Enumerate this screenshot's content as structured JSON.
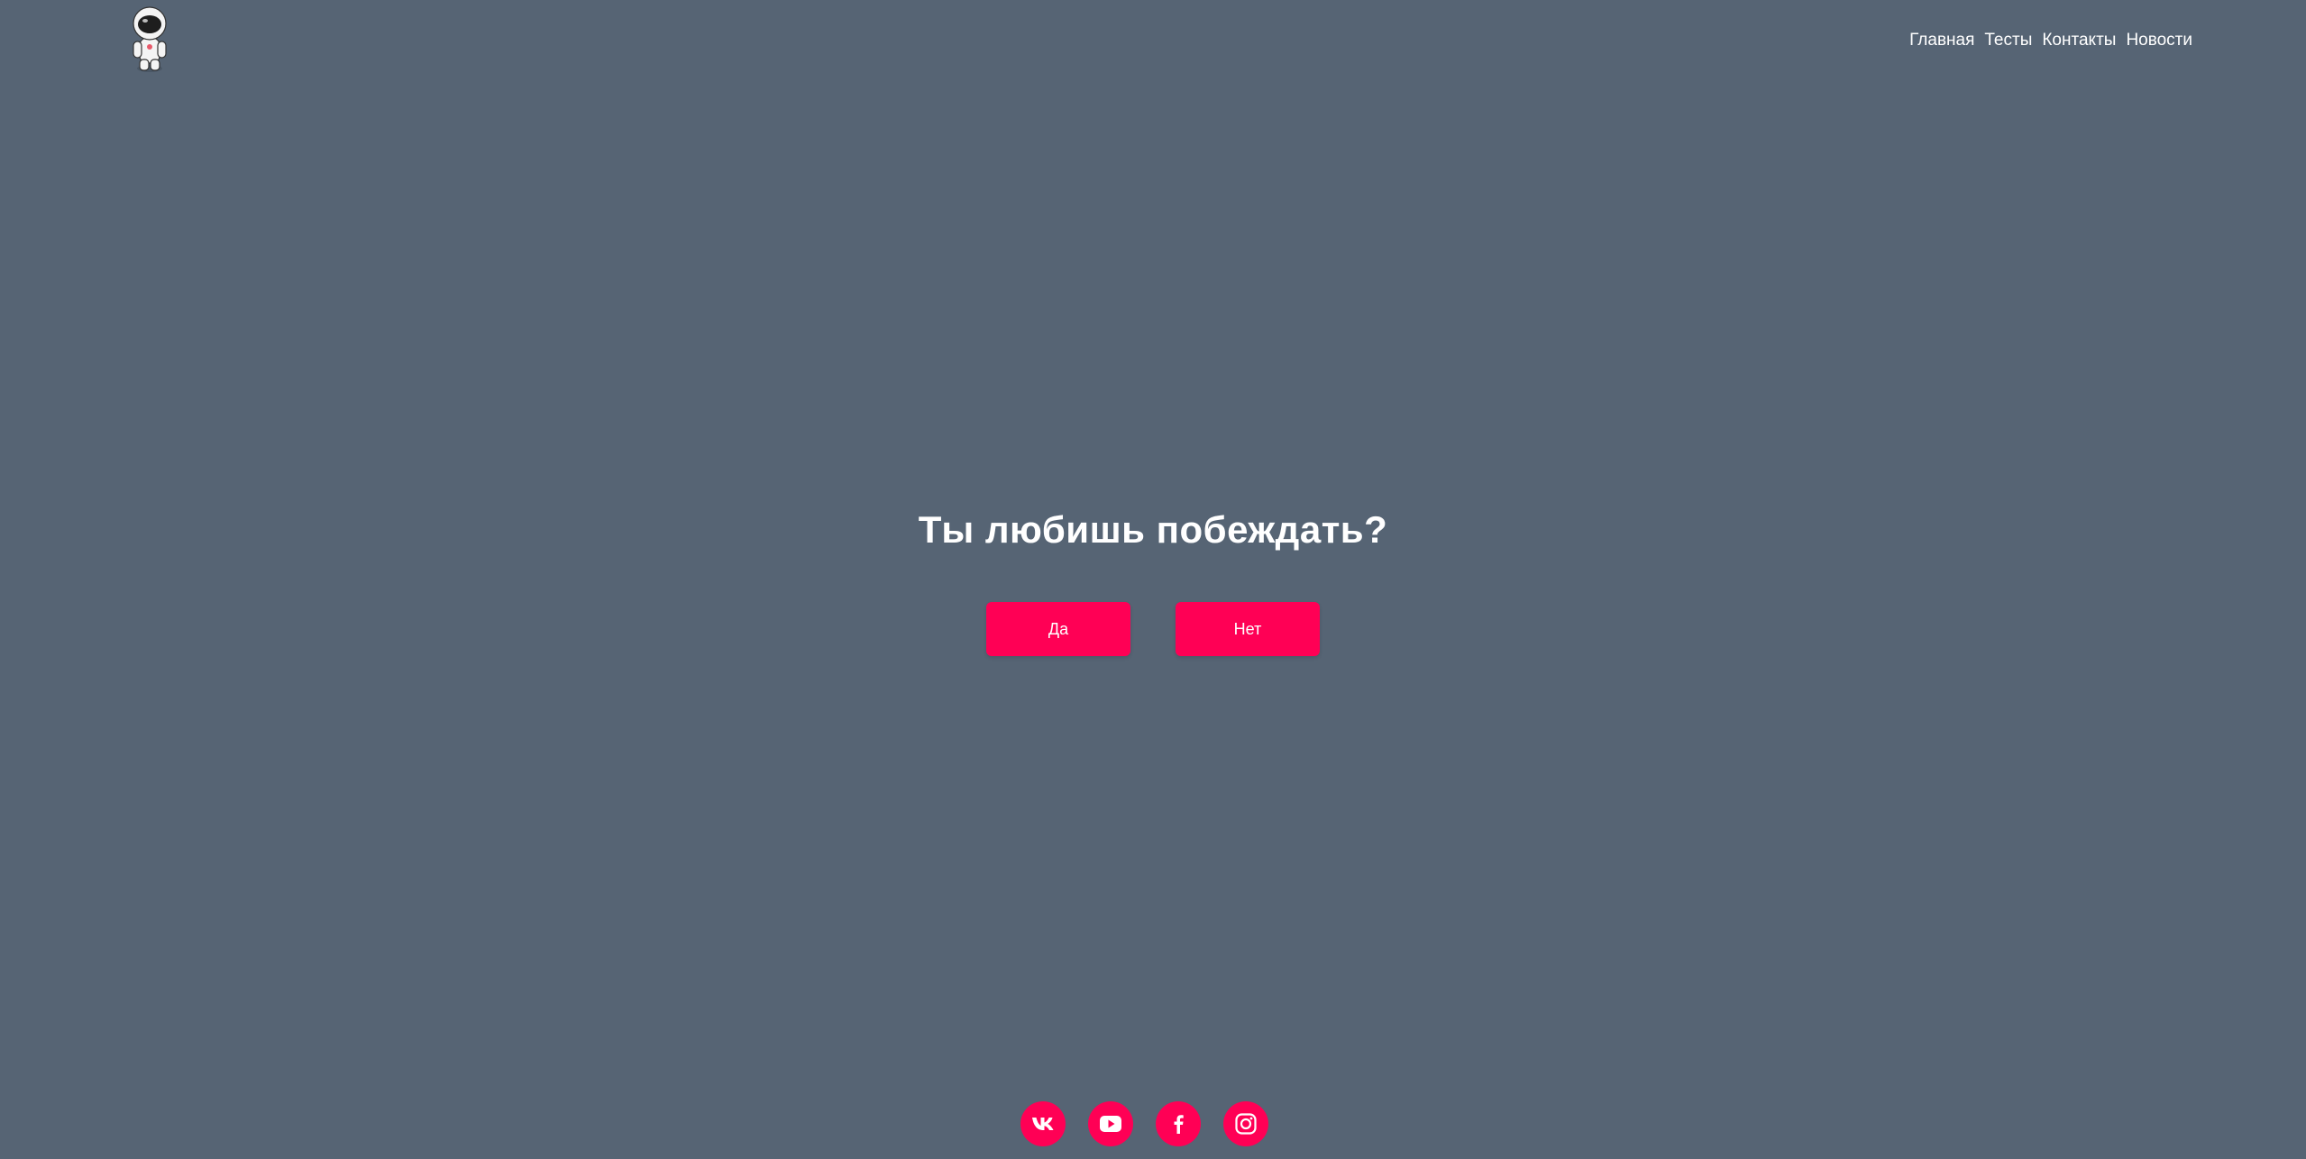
{
  "theme": {
    "background": "#566474",
    "accent": "#ff0055",
    "text": "#ffffff"
  },
  "header": {
    "logo_icon": "astronaut-icon",
    "nav": [
      {
        "label": "Главная"
      },
      {
        "label": "Тесты"
      },
      {
        "label": "Контакты"
      },
      {
        "label": "Новости"
      }
    ]
  },
  "main": {
    "question": "Ты любишь побеждать?",
    "yes_label": "Да",
    "no_label": "Нет"
  },
  "footer": {
    "social": [
      {
        "icon": "vk-icon"
      },
      {
        "icon": "youtube-icon"
      },
      {
        "icon": "facebook-icon"
      },
      {
        "icon": "instagram-icon"
      }
    ]
  }
}
